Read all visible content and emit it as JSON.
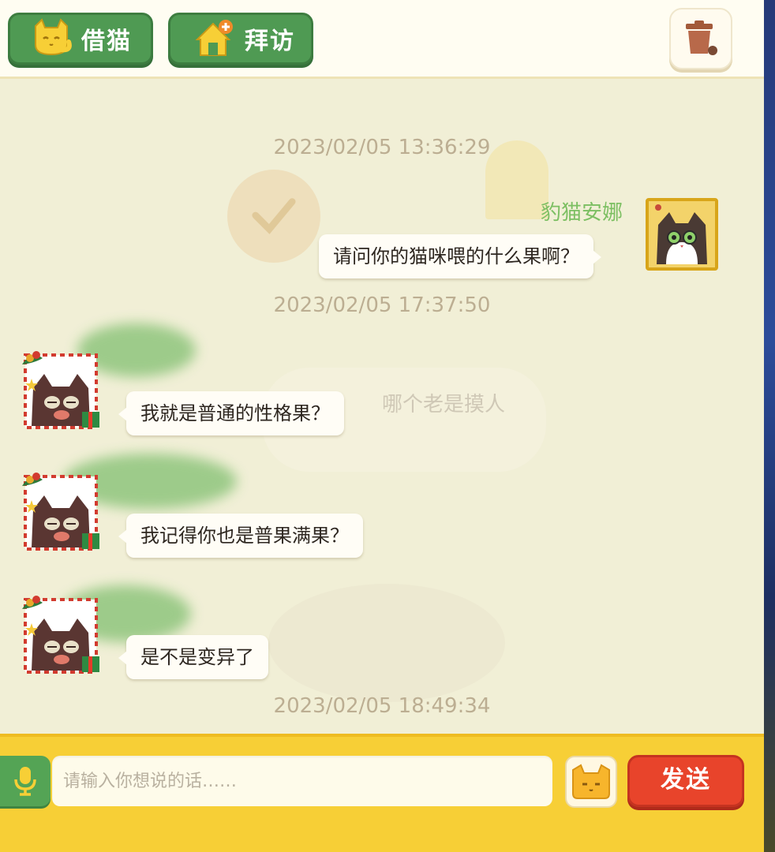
{
  "header": {
    "borrow_label": "借猫",
    "visit_label": "拜访"
  },
  "background": {
    "bubble_text": "哪个老是摸人"
  },
  "chat": {
    "timestamps": [
      "2023/02/05 13:36:29",
      "2023/02/05 17:37:50",
      "2023/02/05 18:49:34"
    ],
    "messages": [
      {
        "side": "right",
        "sender": "豹猫安娜",
        "text": "请问你的猫咪喂的什么果啊？"
      },
      {
        "side": "left",
        "sender": "",
        "text": "我就是普通的性格果？"
      },
      {
        "side": "left",
        "sender": "",
        "text": "我记得你也是普果满果？"
      },
      {
        "side": "left",
        "sender": "",
        "text": "是不是变异了"
      }
    ]
  },
  "input": {
    "placeholder": "请输入你想说的话……",
    "value": ""
  },
  "send_label": "发送",
  "colors": {
    "header_button_green": "#4f9a53",
    "send_red": "#e8442b",
    "bottom_bar_yellow": "#f7cf36",
    "sender_name_green": "#7cbf62",
    "timestamp_tan": "#bcae92"
  },
  "icons": {
    "borrow": "cat-icon",
    "visit": "house-plus-icon",
    "trash": "trash-can-icon",
    "mic": "microphone-icon",
    "emoji": "cat-face-icon"
  }
}
